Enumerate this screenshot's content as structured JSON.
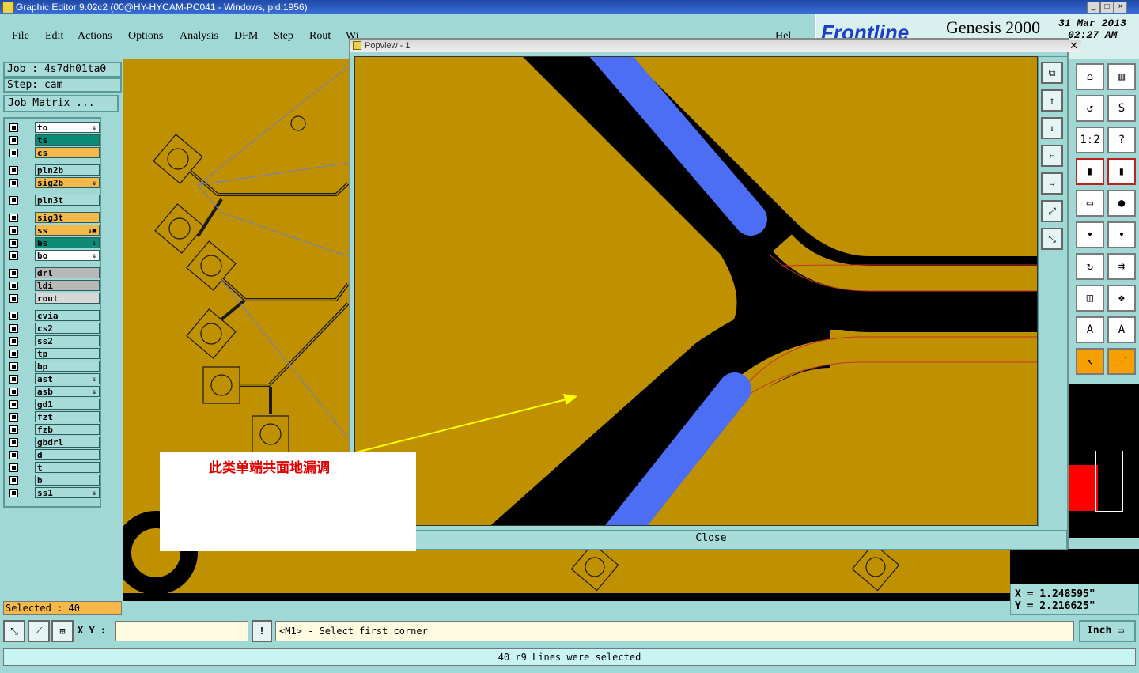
{
  "window": {
    "title": "Graphic Editor 9.02c2 (00@HY-HYCAM-PC041 - Windows, pid:1956)"
  },
  "menu": {
    "items": [
      "File",
      "Edit",
      "Actions",
      "Options",
      "Analysis",
      "DFM",
      "Step",
      "Rout",
      "Wi"
    ],
    "help": "Hel"
  },
  "brand": {
    "logo": "Frontline",
    "product": "Genesis 2000",
    "date": "31 Mar 2013",
    "time": "02:27 AM"
  },
  "job": {
    "job": "Job : 4s7dh01ta0",
    "step": "Step: cam",
    "matrix_button": "Job Matrix ..."
  },
  "layers": [
    {
      "name": "to",
      "color": "#ffffff",
      "mark": "⇓"
    },
    {
      "name": "ts",
      "color": "#0e8b76",
      "mark": ""
    },
    {
      "name": "cs",
      "color": "#f5b94a",
      "mark": ""
    },
    {
      "name": "pln2b",
      "color": "#a8dcd8",
      "mark": ""
    },
    {
      "name": "sig2b",
      "color": "#f5b94a",
      "mark": "⇓"
    },
    {
      "name": "pln3t",
      "color": "#a8dcd8",
      "mark": ""
    },
    {
      "name": "sig3t",
      "color": "#f5b94a",
      "mark": ""
    },
    {
      "name": "ss",
      "color": "#f5b94a",
      "mark": "⇓▣"
    },
    {
      "name": "bs",
      "color": "#0e8b76",
      "mark": "⇓"
    },
    {
      "name": "bo",
      "color": "#ffffff",
      "mark": "⇓"
    },
    {
      "name": "drl",
      "color": "#b8b8b8",
      "mark": ""
    },
    {
      "name": "ldi",
      "color": "#b8b8b8",
      "mark": ""
    },
    {
      "name": "rout",
      "color": "#d8d8d8",
      "mark": ""
    },
    {
      "name": "cvia",
      "color": "#a8dcd8",
      "mark": ""
    },
    {
      "name": "cs2",
      "color": "#a8dcd8",
      "mark": ""
    },
    {
      "name": "ss2",
      "color": "#a8dcd8",
      "mark": ""
    },
    {
      "name": "tp",
      "color": "#a8dcd8",
      "mark": ""
    },
    {
      "name": "bp",
      "color": "#a8dcd8",
      "mark": ""
    },
    {
      "name": "ast",
      "color": "#a8dcd8",
      "mark": "⇓"
    },
    {
      "name": "asb",
      "color": "#a8dcd8",
      "mark": "⇓"
    },
    {
      "name": "gd1",
      "color": "#a8dcd8",
      "mark": ""
    },
    {
      "name": "fzt",
      "color": "#a8dcd8",
      "mark": ""
    },
    {
      "name": "fzb",
      "color": "#a8dcd8",
      "mark": ""
    },
    {
      "name": "gbdrl",
      "color": "#a8dcd8",
      "mark": ""
    },
    {
      "name": "d",
      "color": "#a8dcd8",
      "mark": ""
    },
    {
      "name": "t",
      "color": "#a8dcd8",
      "mark": ""
    },
    {
      "name": "b",
      "color": "#a8dcd8",
      "mark": ""
    },
    {
      "name": "ss1",
      "color": "#a8dcd8",
      "mark": "⇓"
    }
  ],
  "popup": {
    "title": "Popview - 1",
    "close": "Close"
  },
  "annotation": {
    "text": "此类单端共面地漏调"
  },
  "status": {
    "selected": "Selected : 40",
    "xy_label": "X Y :",
    "xy_value": "",
    "prompt": "<M1> - Select first corner",
    "units": "Inch",
    "message": "40 r9 Lines were selected",
    "x": "X = 1.248595\"",
    "y": "Y = 2.216625\""
  },
  "tools": {
    "r1": [
      "⌂",
      "▥"
    ],
    "r2": [
      "↺",
      "S"
    ],
    "r3": [
      "1:2",
      "?"
    ],
    "r4": [
      "▮",
      "▮"
    ],
    "r5": [
      "▭",
      "●"
    ],
    "r6": [
      "•",
      "•"
    ],
    "r7": [
      "↻",
      "⇉"
    ],
    "r8": [
      "◫",
      "❖"
    ],
    "r9": [
      "A",
      "A"
    ],
    "r10": [
      "↖",
      "⋰"
    ]
  }
}
